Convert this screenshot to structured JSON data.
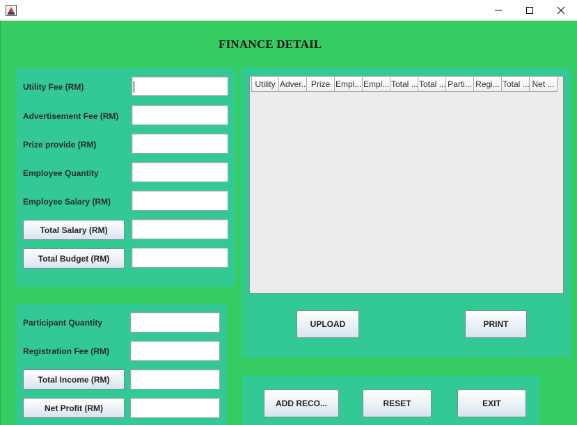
{
  "window": {
    "icon": "java-app-icon",
    "controls": [
      "minimize-icon",
      "maximize-icon",
      "close-icon"
    ]
  },
  "heading": "FINANCE DETAIL",
  "expenses": {
    "utility_label": "Utility Fee (RM)",
    "advertisement_label": "Advertisement Fee (RM)",
    "prize_label": "Prize provide (RM)",
    "employee_qty_label": "Employee Quantity",
    "employee_salary_label": "Employee Salary (RM)",
    "total_salary_button": "Total Salary (RM)",
    "total_budget_button": "Total Budget (RM)",
    "utility_value": "",
    "advertisement_value": "",
    "prize_value": "",
    "employee_qty_value": "",
    "employee_salary_value": "",
    "total_salary_value": "",
    "total_budget_value": ""
  },
  "income": {
    "participant_qty_label": "Participant Quantity",
    "registration_fee_label": "Registration Fee (RM)",
    "total_income_button": "Total Income (RM)",
    "net_profit_button": "Net Profit (RM)",
    "participant_qty_value": "",
    "registration_fee_value": "",
    "total_income_value": "",
    "net_profit_value": ""
  },
  "table": {
    "columns": [
      "Utility",
      "Adver...",
      "Prize",
      "Empl...",
      "Empl...",
      "Total ...",
      "Total ...",
      "Parti...",
      "Regi...",
      "Total ...",
      "Net ..."
    ],
    "rows": []
  },
  "actions": {
    "upload": "UPLOAD",
    "print": "PRINT",
    "add_record": "ADD RECO...",
    "reset": "RESET",
    "exit": "EXIT"
  },
  "colors": {
    "frame_bg": "#35cd61",
    "panel_bg": "#33c995"
  }
}
